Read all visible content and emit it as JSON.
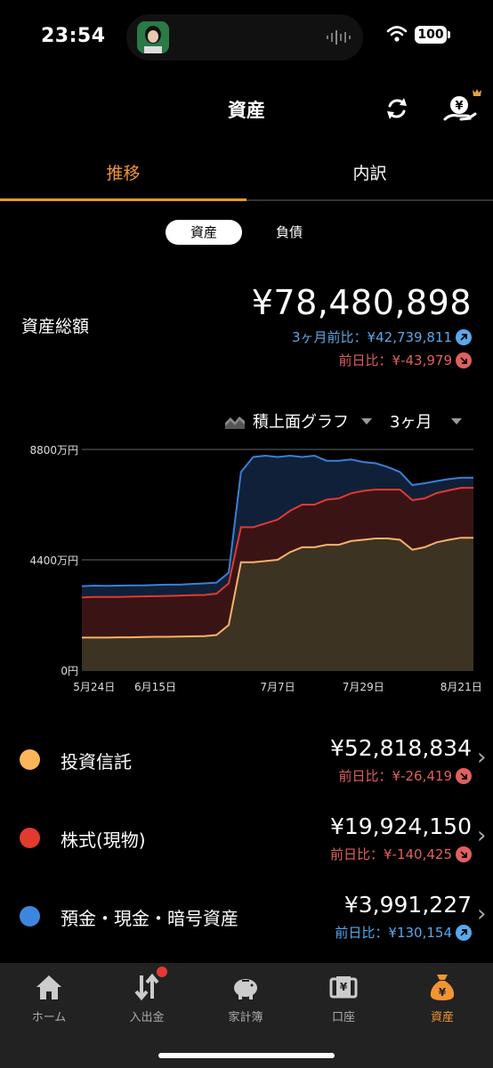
{
  "status": {
    "time": "23:54",
    "battery": "100"
  },
  "header": {
    "title": "資産"
  },
  "tabs": [
    {
      "label": "推移"
    },
    {
      "label": "内訳"
    }
  ],
  "segments": [
    {
      "label": "資産"
    },
    {
      "label": "負債"
    }
  ],
  "summary": {
    "label": "資産総額",
    "total": "¥78,480,898",
    "three_month_compare": "3ヶ月前比：¥42,739,811",
    "prev_day_compare": "前日比：¥-43,979"
  },
  "chart_controls": {
    "chart_type": "積上面グラフ",
    "period": "3ヶ月"
  },
  "chart_data": {
    "type": "area",
    "stacked": true,
    "y_tick_labels": [
      "8800万円",
      "4400万円",
      "0円"
    ],
    "x_tick_labels": [
      "5月24日",
      "6月15日",
      "7月7日",
      "7月29日",
      "8月21日"
    ],
    "ylim": [
      0,
      88000000
    ],
    "x": [
      "5月20日",
      "5月24日",
      "5月28日",
      "6月1日",
      "6月5日",
      "6月9日",
      "6月15日",
      "6月20日",
      "6月25日",
      "6月28日",
      "6月30日",
      "7月1日",
      "7月2日",
      "7月3日",
      "7月4日",
      "7月5日",
      "7月7日",
      "7月10日",
      "7月13日",
      "7月16日",
      "7月19日",
      "7月22日",
      "7月25日",
      "7月29日",
      "8月1日",
      "8月4日",
      "8月7日",
      "8月10日",
      "8月13日",
      "8月16日",
      "8月19日",
      "8月21日",
      "8月25日"
    ],
    "series": [
      {
        "name": "投資信託",
        "color": "#f7b26a",
        "values": [
          13000000,
          13000000,
          13000000,
          13100000,
          13100000,
          13200000,
          13300000,
          13300000,
          13400000,
          13500000,
          13600000,
          14000000,
          18000000,
          43000000,
          43000000,
          43500000,
          44000000,
          47000000,
          49000000,
          49000000,
          50000000,
          50000000,
          51500000,
          52000000,
          52500000,
          52500000,
          52000000,
          48000000,
          49000000,
          51000000,
          52000000,
          52800000,
          52800000
        ]
      },
      {
        "name": "株式(現物)",
        "color": "#e03a33",
        "values": [
          16000000,
          16200000,
          16200000,
          16100000,
          16200000,
          16200000,
          16200000,
          16300000,
          16300000,
          16400000,
          16400000,
          16500000,
          16600000,
          14000000,
          14000000,
          15000000,
          16000000,
          16500000,
          17000000,
          17000000,
          18000000,
          18500000,
          19000000,
          19500000,
          19500000,
          19500000,
          20000000,
          19800000,
          19500000,
          19600000,
          19700000,
          19900000,
          19900000
        ]
      },
      {
        "name": "預金・現金・暗号資産",
        "color": "#3a7fd5",
        "values": [
          4500000,
          4500000,
          4400000,
          4500000,
          4500000,
          4400000,
          4500000,
          4500000,
          4400000,
          4500000,
          4600000,
          4400000,
          4300000,
          22000000,
          28000000,
          27000000,
          25000000,
          22000000,
          19000000,
          19500000,
          15500000,
          15000000,
          13500000,
          11500000,
          10500000,
          9000000,
          7000000,
          6000000,
          6000000,
          4800000,
          4500000,
          4000000,
          4000000
        ]
      }
    ]
  },
  "categories": [
    {
      "name": "投資信託",
      "value": "¥52,818,834",
      "sub": "前日比：¥-26,419",
      "color": "#fdb55c",
      "trend": "down"
    },
    {
      "name": "株式(現物)",
      "value": "¥19,924,150",
      "sub": "前日比：¥-140,425",
      "color": "#e23a2e",
      "trend": "down"
    },
    {
      "name": "預金・現金・暗号資産",
      "value": "¥3,991,227",
      "sub": "前日比：¥130,154",
      "color": "#3d86e0",
      "trend": "up"
    }
  ],
  "nav": [
    {
      "label": "ホーム"
    },
    {
      "label": "入出金"
    },
    {
      "label": "家計簿"
    },
    {
      "label": "口座"
    },
    {
      "label": "資産"
    }
  ],
  "colors": {
    "accent": "#f29531",
    "up": "#59a8ea",
    "down": "#e0605e"
  }
}
